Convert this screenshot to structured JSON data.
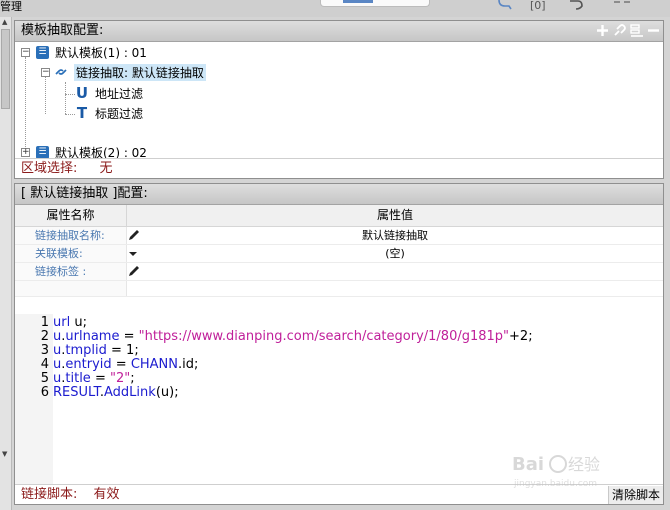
{
  "window": {
    "top_label": "管理",
    "top_icon_zero": "[0]"
  },
  "template_panel": {
    "title": "模板抽取配置:",
    "tree": [
      {
        "label": "默认模板(1) : 01",
        "icon": "template-icon"
      },
      {
        "label": "链接抽取: 默认链接抽取",
        "icon": "link-icon"
      },
      {
        "label": "地址过滤",
        "icon": "u-letter-icon",
        "letter": "U"
      },
      {
        "label": "标题过滤",
        "icon": "t-letter-icon",
        "letter": "T"
      },
      {
        "label": "默认模板(2) : 02",
        "icon": "template-icon"
      }
    ],
    "region_label": "区域选择:",
    "region_value": "无"
  },
  "link_panel": {
    "title": "[ 默认链接抽取 ]配置:",
    "headers": {
      "name": "属性名称",
      "value": "属性值"
    },
    "rows": [
      {
        "name": "链接抽取名称:",
        "value": "默认链接抽取",
        "icon": "pencil-icon"
      },
      {
        "name": "关联模板:",
        "value": "(空)",
        "icon": "dropdown-arrow-icon"
      },
      {
        "name": "链接标签 :",
        "value": "",
        "icon": "pencil-icon"
      }
    ],
    "code_lines": [
      {
        "num": "1",
        "parts": [
          [
            "kw",
            "url"
          ],
          [
            "plain",
            " u;"
          ]
        ]
      },
      {
        "num": "2",
        "parts": [
          [
            "kw",
            "u"
          ],
          [
            "plain",
            "."
          ],
          [
            "kw",
            "urlname"
          ],
          [
            "plain",
            " = "
          ],
          [
            "str",
            "\"https://www.dianping.com/search/category/1/80/g181p\""
          ],
          [
            "plain",
            "+2;"
          ]
        ]
      },
      {
        "num": "3",
        "parts": [
          [
            "kw",
            "u"
          ],
          [
            "plain",
            "."
          ],
          [
            "kw",
            "tmplid"
          ],
          [
            "plain",
            " = 1;"
          ]
        ]
      },
      {
        "num": "4",
        "parts": [
          [
            "kw",
            "u"
          ],
          [
            "plain",
            "."
          ],
          [
            "kw",
            "entryid"
          ],
          [
            "plain",
            " = "
          ],
          [
            "kw",
            "CHANN"
          ],
          [
            "plain",
            ".id;"
          ]
        ]
      },
      {
        "num": "5",
        "parts": [
          [
            "kw",
            "u"
          ],
          [
            "plain",
            "."
          ],
          [
            "kw",
            "title"
          ],
          [
            "plain",
            " = "
          ],
          [
            "str",
            "\"2\""
          ],
          [
            "plain",
            ";"
          ]
        ]
      },
      {
        "num": "6",
        "parts": [
          [
            "kw",
            "RESULT"
          ],
          [
            "plain",
            "."
          ],
          [
            "kw",
            "AddLink"
          ],
          [
            "plain",
            "(u);"
          ]
        ]
      }
    ],
    "script_label": "链接脚本:",
    "script_value": "有效",
    "clear_button": "清除脚本"
  },
  "watermark": {
    "text": "Baidu 经验",
    "sub": "jingyan.baidu.com"
  },
  "colors": {
    "accent": "#2a6fb8",
    "status_red": "#8b1a1a",
    "link_text": "#4a78b0"
  }
}
